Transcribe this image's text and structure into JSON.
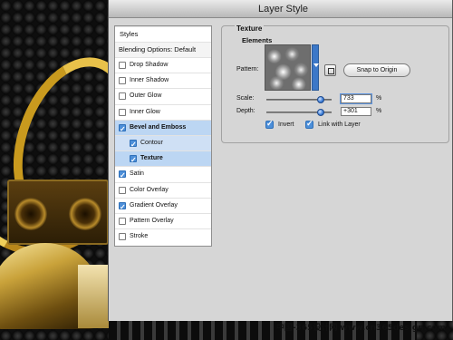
{
  "window": {
    "title": "Layer Style"
  },
  "styles_list": {
    "header": "Styles",
    "blending_options": "Blending Options: Default",
    "items": [
      {
        "label": "Drop Shadow",
        "checked": false,
        "selected": false,
        "sub": false
      },
      {
        "label": "Inner Shadow",
        "checked": false,
        "selected": false,
        "sub": false
      },
      {
        "label": "Outer Glow",
        "checked": false,
        "selected": false,
        "sub": false
      },
      {
        "label": "Inner Glow",
        "checked": false,
        "selected": false,
        "sub": false
      },
      {
        "label": "Bevel and Emboss",
        "checked": true,
        "selected": true,
        "sub": false
      },
      {
        "label": "Contour",
        "checked": true,
        "selected": false,
        "sub": true
      },
      {
        "label": "Texture",
        "checked": true,
        "selected": true,
        "sub": true
      },
      {
        "label": "Satin",
        "checked": true,
        "selected": false,
        "sub": false
      },
      {
        "label": "Color Overlay",
        "checked": false,
        "selected": false,
        "sub": false
      },
      {
        "label": "Gradient Overlay",
        "checked": true,
        "selected": false,
        "sub": false
      },
      {
        "label": "Pattern Overlay",
        "checked": false,
        "selected": false,
        "sub": false
      },
      {
        "label": "Stroke",
        "checked": false,
        "selected": false,
        "sub": false
      }
    ]
  },
  "texture": {
    "heading": "Texture",
    "elements_heading": "Elements",
    "pattern_label": "Pattern:",
    "snap_button": "Snap to Origin",
    "scale_label": "Scale:",
    "scale_value": "733",
    "scale_unit": "%",
    "scale_fraction": 0.84,
    "depth_label": "Depth:",
    "depth_value": "+301",
    "depth_unit": "%",
    "depth_fraction": 0.84,
    "invert_label": "Invert",
    "invert_checked": true,
    "link_label": "Link with Layer",
    "link_checked": true
  },
  "watermark": "中国-365设计网 www.cn365design.com",
  "colors": {
    "selection": "#bcd6f3",
    "accent": "#3c78c8"
  },
  "icons": {
    "pattern_dropdown": "chevron-down-icon",
    "new_preset": "new-preset-icon"
  }
}
